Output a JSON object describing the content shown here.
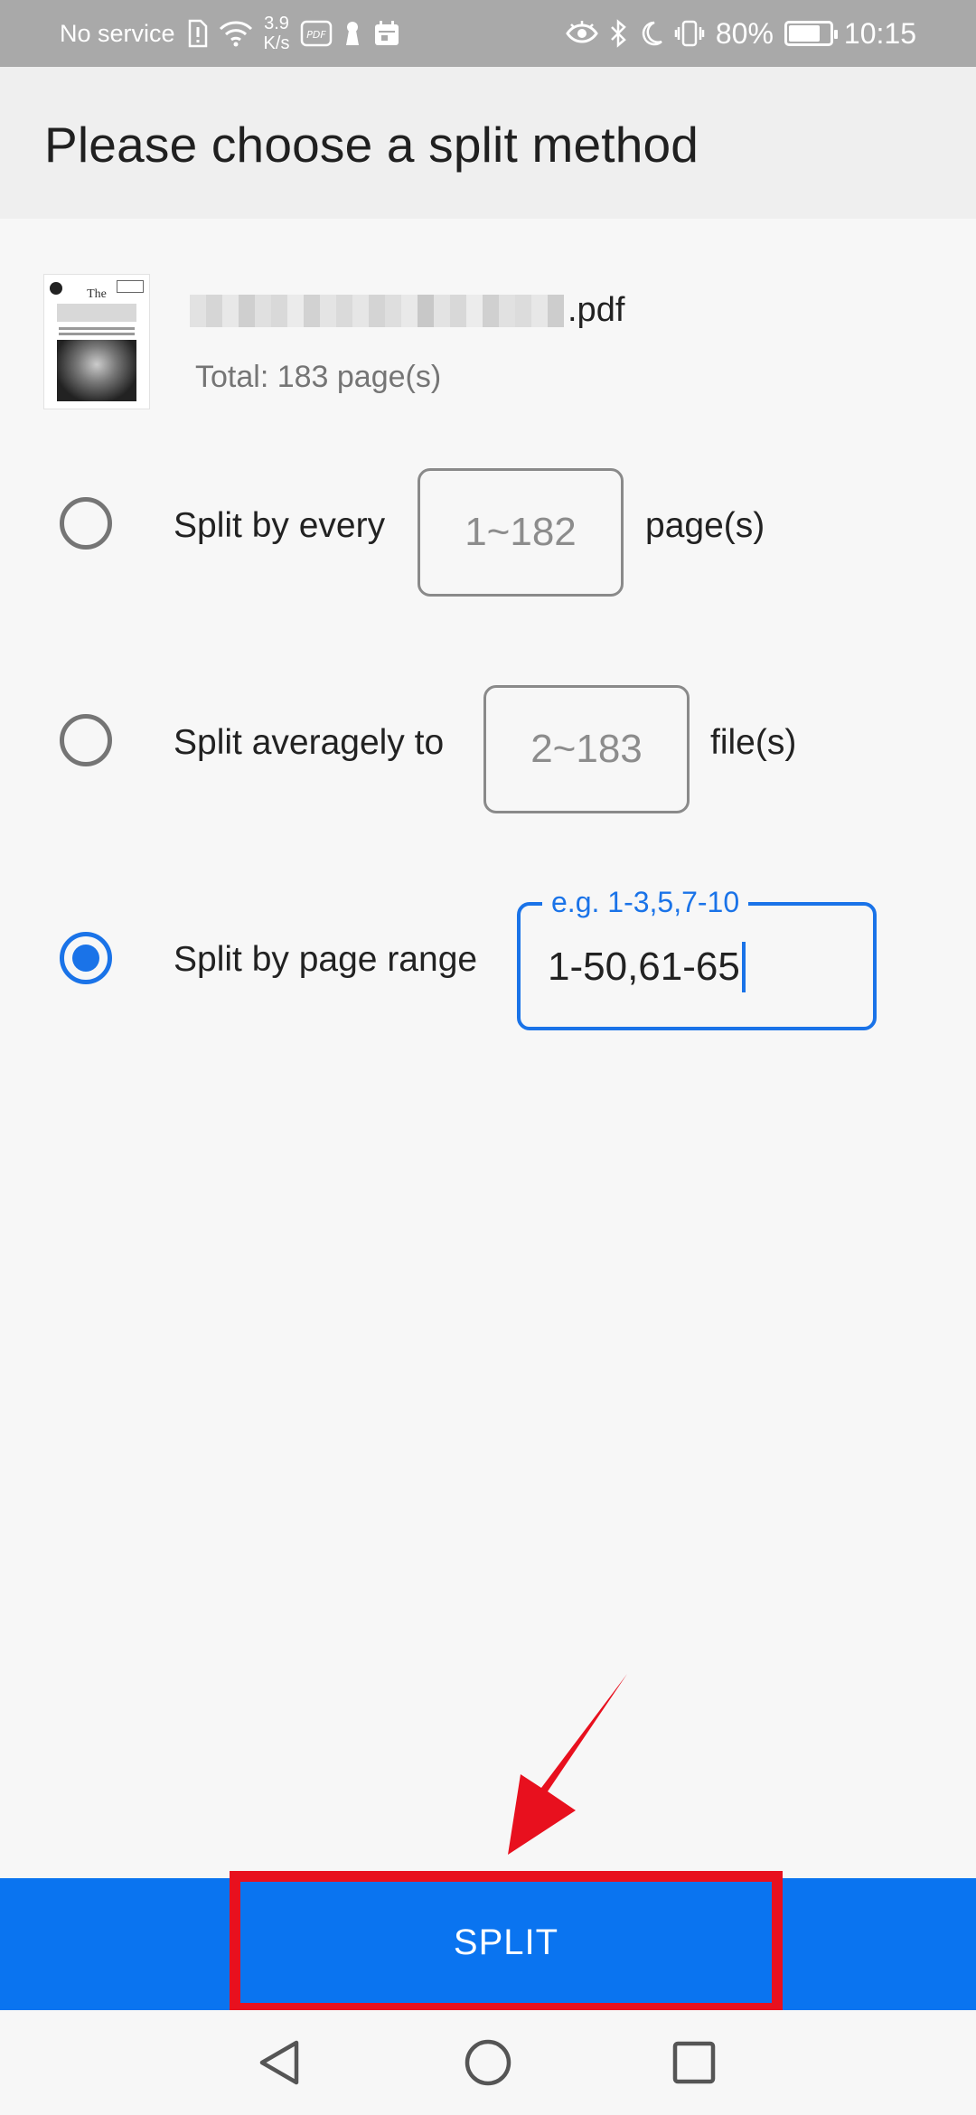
{
  "status_bar": {
    "carrier": "No service",
    "speed_value": "3.9",
    "speed_unit": "K/s",
    "battery": "80%",
    "battery_level": 0.8,
    "time": "10:15"
  },
  "header": {
    "title": "Please choose a split method"
  },
  "file": {
    "name_suffix": ".pdf",
    "total": "Total: 183 page(s)"
  },
  "options": {
    "every": {
      "label": "Split by every",
      "placeholder": "1~182",
      "suffix": "page(s)",
      "selected": false
    },
    "average": {
      "label": "Split averagely to",
      "placeholder": "2~183",
      "suffix": "file(s)",
      "selected": false
    },
    "range": {
      "label": "Split by page range",
      "hint": "e.g. 1-3,5,7-10",
      "value": "1-50,61-65",
      "selected": true
    }
  },
  "actions": {
    "split_label": "SPLIT"
  },
  "colors": {
    "accent": "#1a73e8",
    "button_bg": "#0a74f0",
    "highlight": "#e8101e"
  }
}
